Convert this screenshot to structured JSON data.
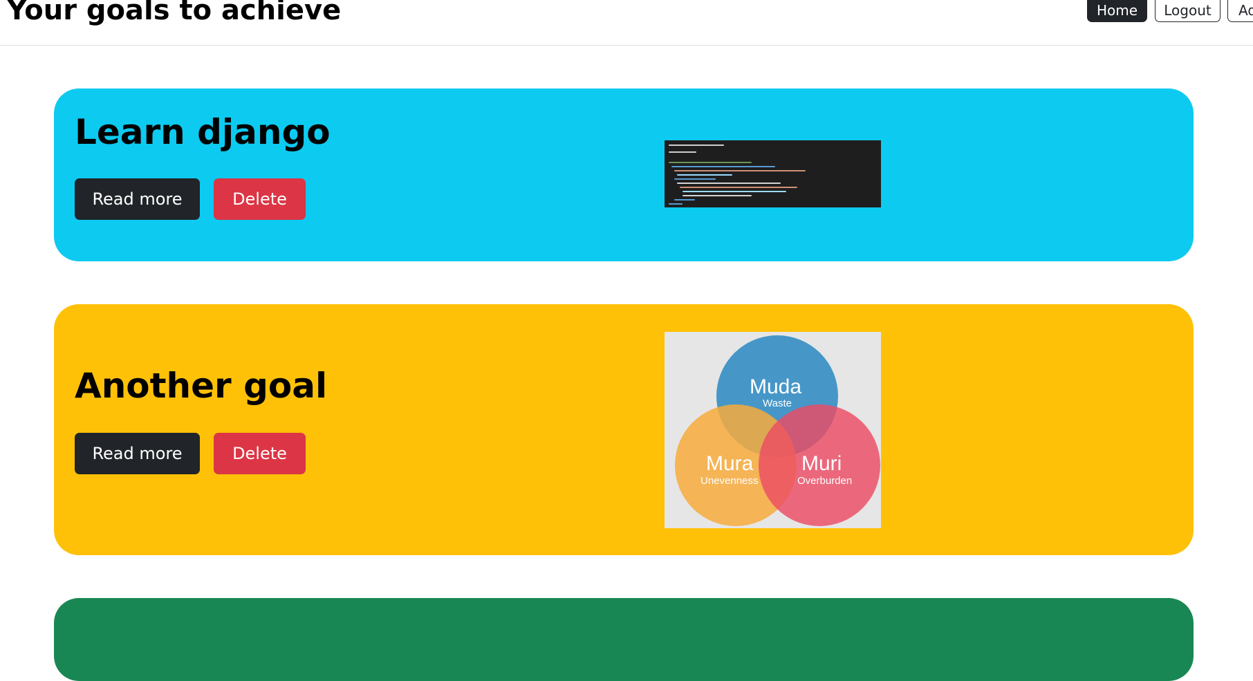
{
  "header": {
    "title": "Your goals to achieve",
    "nav": {
      "home_label": "Home",
      "logout_label": "Logout",
      "add_label": "Ad"
    }
  },
  "goals": [
    {
      "title": "Learn django",
      "read_more_label": "Read more",
      "delete_label": "Delete",
      "color": "#0dcaf0",
      "image": "code-editor-screenshot"
    },
    {
      "title": "Another goal",
      "read_more_label": "Read more",
      "delete_label": "Delete",
      "color": "#ffc107",
      "image": "venn-diagram",
      "venn": {
        "muda": "Muda",
        "muda_sub": "Waste",
        "mura": "Mura",
        "mura_sub": "Unevenness",
        "muri": "Muri",
        "muri_sub": "Overburden"
      }
    },
    {
      "color": "#198754"
    }
  ],
  "colors": {
    "dark": "#212529",
    "danger": "#dc3545"
  }
}
